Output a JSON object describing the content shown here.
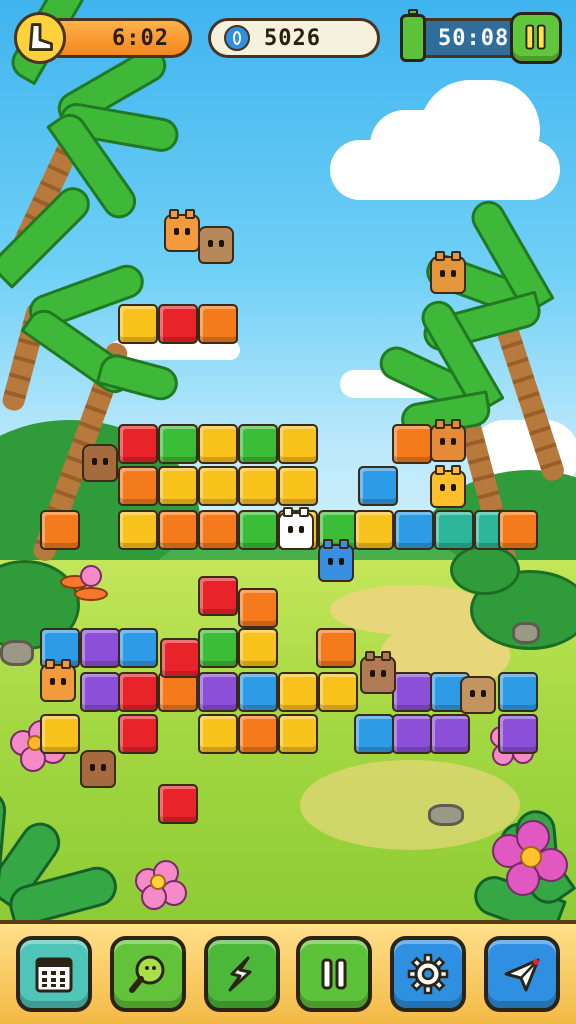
{
  "hud": {
    "level_value": "6:02",
    "coins_value": "5026",
    "timer_value": "50:08"
  },
  "icons": {
    "level_badge": "boot-icon",
    "coin": "coin-icon",
    "energy": "battery-icon",
    "pause_top": "pause-icon"
  },
  "bottom_bar": [
    {
      "name": "calendar-button",
      "icon": "calendar-icon",
      "color": "#4fc4b8"
    },
    {
      "name": "search-button",
      "icon": "magnifier-icon",
      "color": "#62c23a"
    },
    {
      "name": "shuffle-button",
      "icon": "sparkle-icon",
      "color": "#4bb83a"
    },
    {
      "name": "pause-button",
      "icon": "pause-icon",
      "color": "#5cc23a"
    },
    {
      "name": "settings-button",
      "icon": "gear-icon",
      "color": "#2f8fe0"
    },
    {
      "name": "send-button",
      "icon": "paper-plane-icon",
      "color": "#2f8fe0"
    }
  ],
  "colors": {
    "red": "#e8242a",
    "orange": "#f57a1c",
    "yellow": "#f9c21d",
    "green": "#3bbd38",
    "blue": "#2d9be6",
    "purple": "#8c4fd8",
    "teal": "#2bb69a",
    "hud_orange": "#f59a2c",
    "hud_green": "#5cc23a"
  }
}
